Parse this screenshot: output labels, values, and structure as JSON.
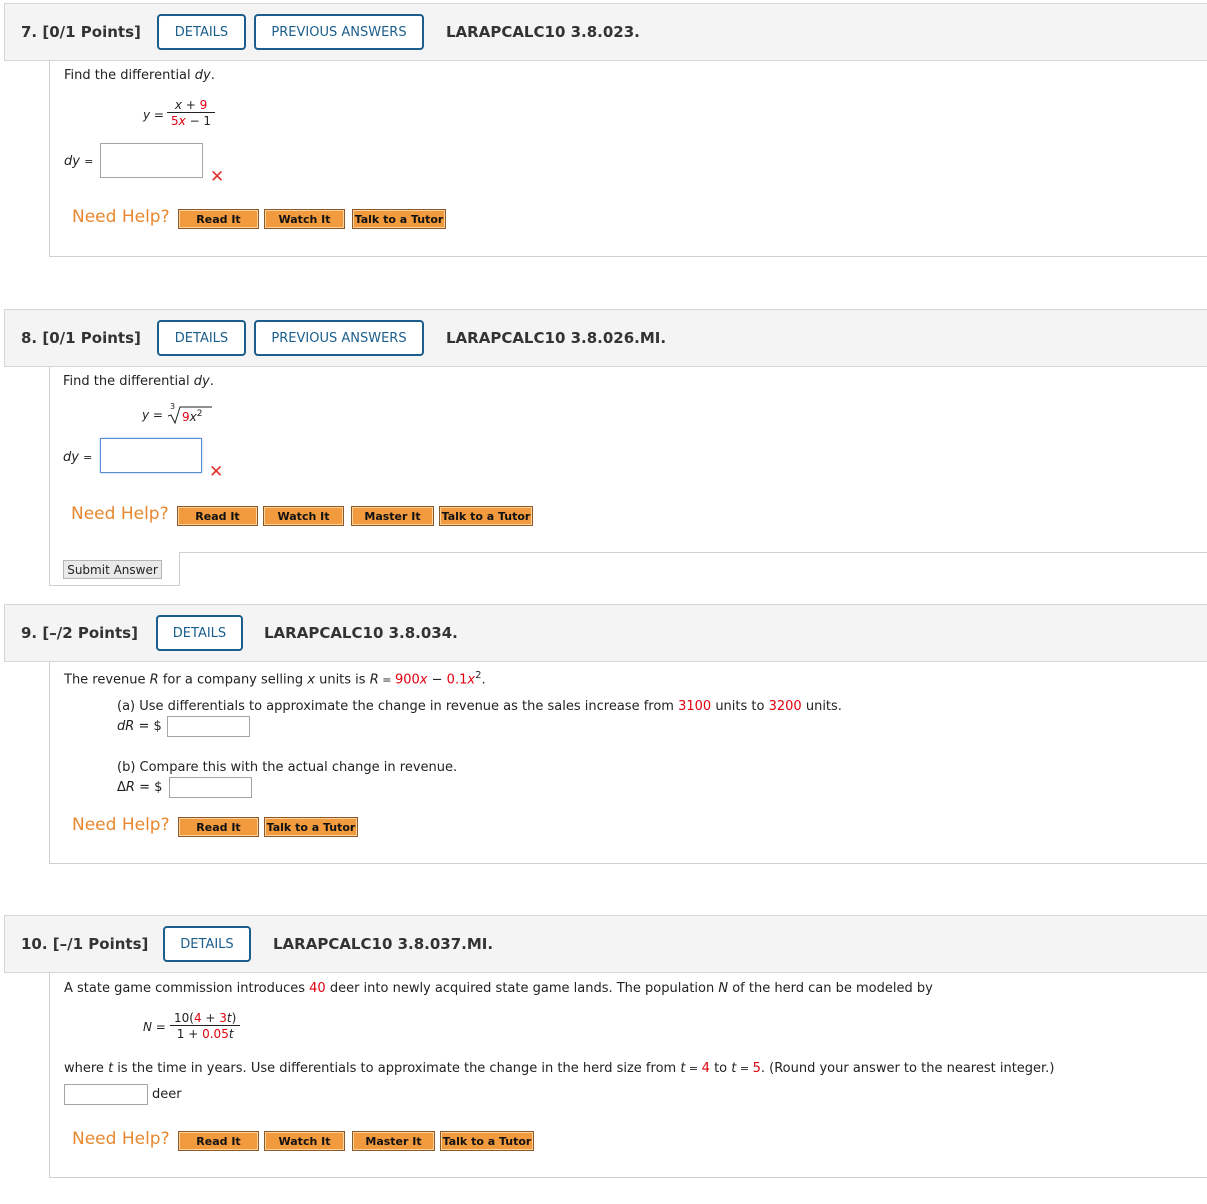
{
  "q7": {
    "label": "7. [0/1 Points]",
    "details": "DETAILS",
    "previous": "PREVIOUS ANSWERS",
    "id": "LARAPCALC10 3.8.023.",
    "prompt_a": "Find the differential ",
    "prompt_var": "dy",
    "prompt_b": ".",
    "y_label": "y =",
    "num_x": "x",
    "num_plus": " + ",
    "num_9": "9",
    "den_5": "5",
    "den_x": "x",
    "den_rest": " − 1",
    "dy_label": "dy",
    "eq": "=",
    "answer": "",
    "mark": "✕",
    "help": "Need Help?",
    "buttons": [
      "Read It",
      "Watch It",
      "Talk to a Tutor"
    ]
  },
  "q8": {
    "label": "8. [0/1 Points]",
    "details": "DETAILS",
    "previous": "PREVIOUS ANSWERS",
    "id": "LARAPCALC10 3.8.026.MI.",
    "prompt_a": "Find the differential ",
    "prompt_var": "dy",
    "prompt_b": ".",
    "y_label": "y =",
    "root_index": "3",
    "radicand_9": "9",
    "radicand_x": "x",
    "radicand_exp": "2",
    "dy_label": "dy",
    "eq": "=",
    "answer": "",
    "mark": "✕",
    "help": "Need Help?",
    "buttons": [
      "Read It",
      "Watch It",
      "Master It",
      "Talk to a Tutor"
    ],
    "submit": "Submit Answer"
  },
  "q9": {
    "label": "9. [–/2 Points]",
    "details": "DETAILS",
    "id": "LARAPCALC10 3.8.034.",
    "s1": "The revenue ",
    "s_R": "R",
    "s2": " for a company selling ",
    "s_x": "x",
    "s3": " units is ",
    "s_R2": "R",
    "s4": " = ",
    "s_900": "900",
    "s_x2": "x",
    "s5": " − ",
    "s_01": "0.1",
    "s_x3": "x",
    "s_exp": "2",
    "s6": ".",
    "a1": "(a) Use differentials to approximate the change in revenue as the sales increase from ",
    "a_3100": "3100",
    "a2": " units to ",
    "a_3200": "3200",
    "a3": " units.",
    "dR_d": "d",
    "dR_R": "R",
    "dR_rest": " = $",
    "b1": "(b) Compare this with the actual change in revenue.",
    "DR_delta": "Δ",
    "DR_R": "R",
    "DR_rest": " = $",
    "help": "Need Help?",
    "buttons": [
      "Read It",
      "Talk to a Tutor"
    ]
  },
  "q10": {
    "label": "10. [–/1 Points]",
    "details": "DETAILS",
    "id": "LARAPCALC10 3.8.037.MI.",
    "s1": "A state game commission introduces ",
    "s_40": "40",
    "s2": " deer into newly acquired state game lands. The population ",
    "s_N": "N",
    "s3": " of the herd can be modeled by",
    "n_label": "N =",
    "num_10": "10(",
    "num_4": "4",
    "num_plus": " + ",
    "num_3": "3",
    "num_t": "t",
    "num_close": ")",
    "den_1": "1 + ",
    "den_005": "0.05",
    "den_t": "t",
    "w1": "where ",
    "w_t": "t",
    "w2": " is the time in years. Use differentials to approximate the change in the herd size from ",
    "w_t2": "t",
    "w3": " = ",
    "w_4": "4",
    "w4": " to ",
    "w_t3": "t",
    "w5": " = ",
    "w_5": "5",
    "w6": ". (Round your answer to the nearest integer.)",
    "unit": "deer",
    "help": "Need Help?",
    "buttons": [
      "Read It",
      "Watch It",
      "Master It",
      "Talk to a Tutor"
    ]
  },
  "colors": {
    "accent_blue": "#1b5e8c",
    "highlight_red": "#e3000f",
    "help_orange": "#e8872e",
    "button_orange": "#f29a3e"
  }
}
